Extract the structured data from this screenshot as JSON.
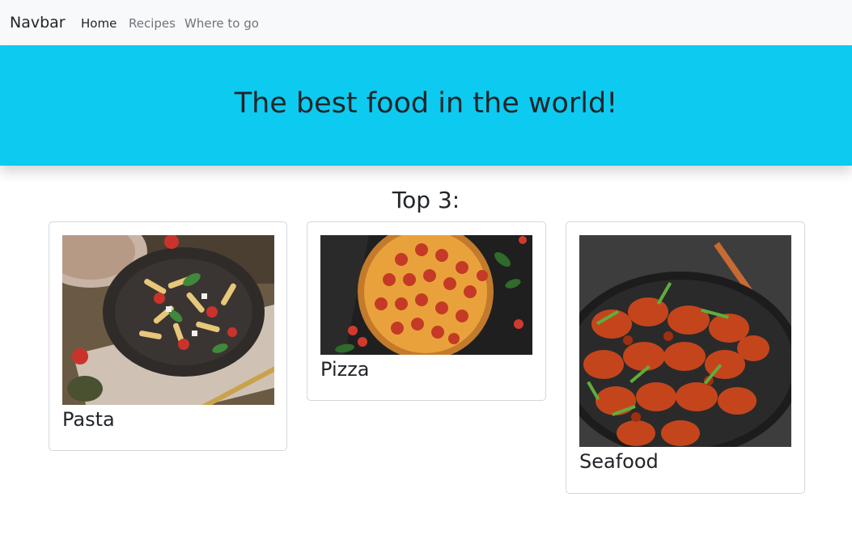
{
  "navbar": {
    "brand": "Navbar",
    "links": [
      {
        "label": "Home",
        "active": true
      },
      {
        "label": "Recipes",
        "active": false
      },
      {
        "label": "Where to go",
        "active": false
      }
    ]
  },
  "hero": {
    "title": "The best food in the world!"
  },
  "main": {
    "section_title": "Top 3:",
    "cards": [
      {
        "title": "Pasta",
        "image": "pasta-salad-photo"
      },
      {
        "title": "Pizza",
        "image": "pepperoni-pizza-photo"
      },
      {
        "title": "Seafood",
        "image": "shrimp-dish-photo"
      }
    ]
  },
  "colors": {
    "navbar_bg": "#f8f9fa",
    "hero_bg": "#0dcaf0",
    "text": "#212529",
    "muted_link": "#6c757d"
  }
}
